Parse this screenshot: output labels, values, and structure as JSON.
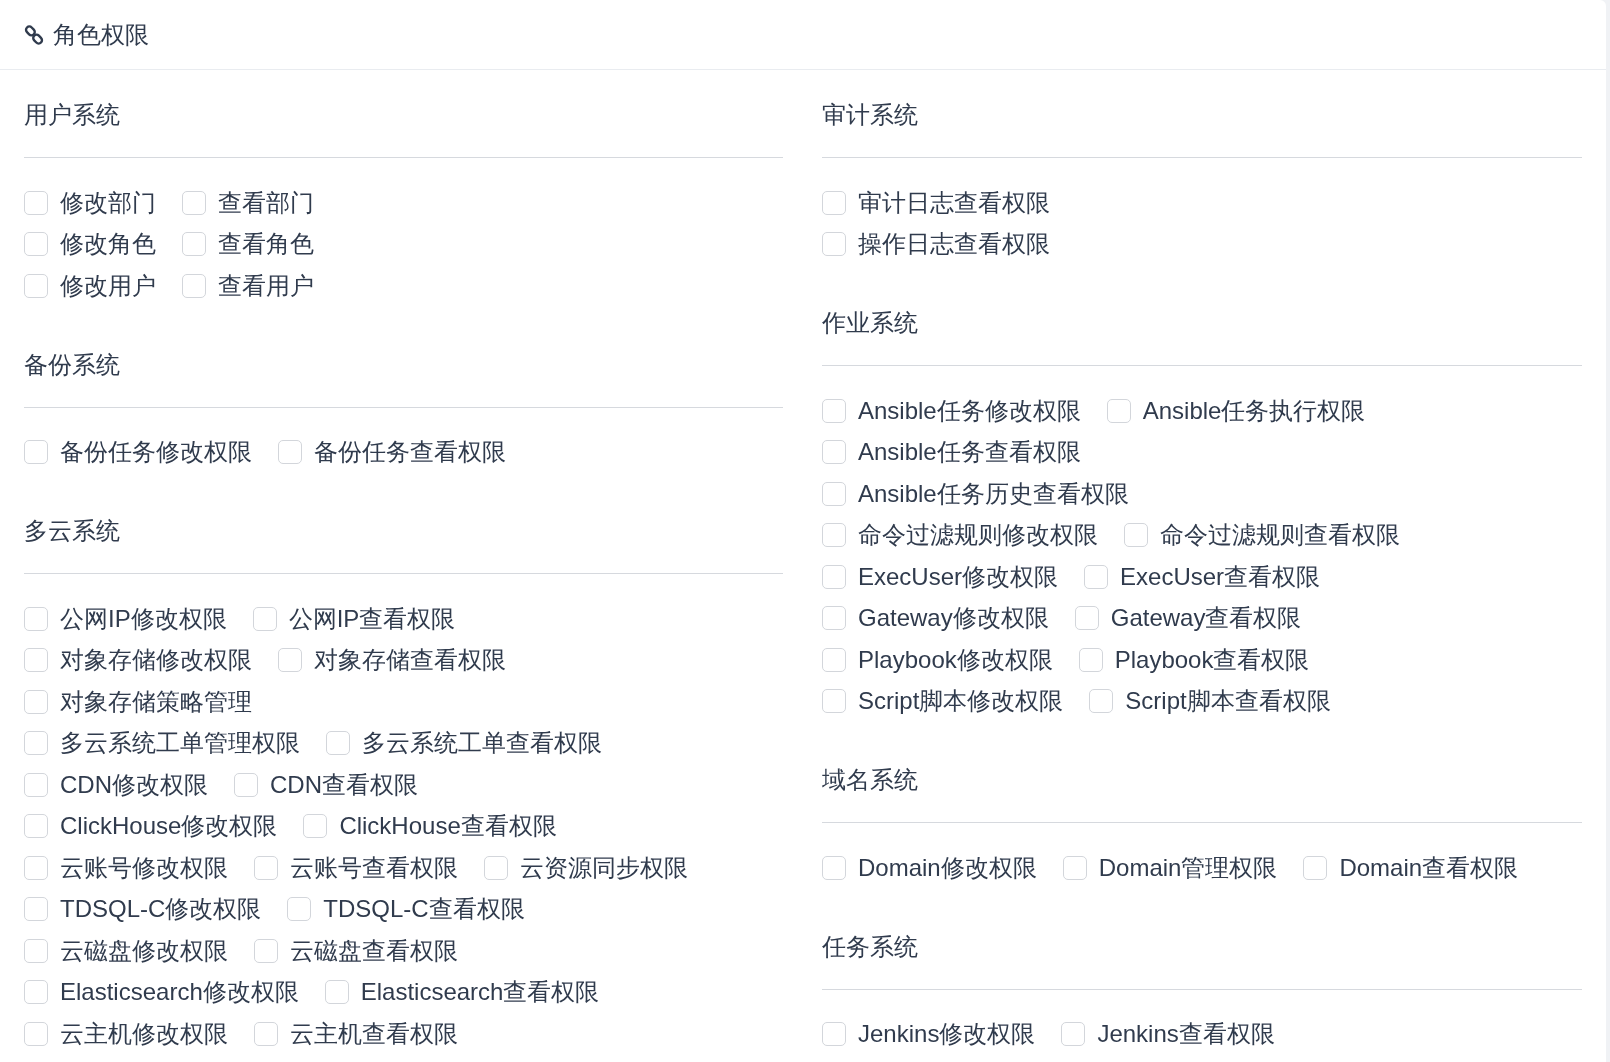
{
  "header": {
    "title": "角色权限"
  },
  "columns": [
    {
      "sections": [
        {
          "title": "用户系统",
          "rows": [
            {
              "options": [
                {
                  "label": "修改部门",
                  "checked": false
                },
                {
                  "label": "查看部门",
                  "checked": false
                }
              ]
            },
            {
              "options": [
                {
                  "label": "修改角色",
                  "checked": false
                },
                {
                  "label": "查看角色",
                  "checked": false
                }
              ]
            },
            {
              "options": [
                {
                  "label": "修改用户",
                  "checked": false
                },
                {
                  "label": "查看用户",
                  "checked": false
                }
              ]
            }
          ]
        },
        {
          "title": "备份系统",
          "rows": [
            {
              "options": [
                {
                  "label": "备份任务修改权限",
                  "checked": false
                },
                {
                  "label": "备份任务查看权限",
                  "checked": false
                }
              ]
            }
          ]
        },
        {
          "title": "多云系统",
          "rows": [
            {
              "options": [
                {
                  "label": "公网IP修改权限",
                  "checked": false
                },
                {
                  "label": "公网IP查看权限",
                  "checked": false
                }
              ]
            },
            {
              "options": [
                {
                  "label": "对象存储修改权限",
                  "checked": false
                },
                {
                  "label": "对象存储查看权限",
                  "checked": false
                }
              ]
            },
            {
              "options": [
                {
                  "label": "对象存储策略管理",
                  "checked": false
                }
              ]
            },
            {
              "options": [
                {
                  "label": "多云系统工单管理权限",
                  "checked": false
                },
                {
                  "label": "多云系统工单查看权限",
                  "checked": false
                }
              ]
            },
            {
              "options": [
                {
                  "label": "CDN修改权限",
                  "checked": false
                },
                {
                  "label": "CDN查看权限",
                  "checked": false
                }
              ]
            },
            {
              "options": [
                {
                  "label": "ClickHouse修改权限",
                  "checked": false
                },
                {
                  "label": "ClickHouse查看权限",
                  "checked": false
                }
              ]
            },
            {
              "options": [
                {
                  "label": "云账号修改权限",
                  "checked": false
                },
                {
                  "label": "云账号查看权限",
                  "checked": false
                },
                {
                  "label": "云资源同步权限",
                  "checked": false
                }
              ]
            },
            {
              "options": [
                {
                  "label": "TDSQL-C修改权限",
                  "checked": false
                },
                {
                  "label": "TDSQL-C查看权限",
                  "checked": false
                }
              ]
            },
            {
              "options": [
                {
                  "label": "云磁盘修改权限",
                  "checked": false
                },
                {
                  "label": "云磁盘查看权限",
                  "checked": false
                }
              ]
            },
            {
              "options": [
                {
                  "label": "Elasticsearch修改权限",
                  "checked": false
                },
                {
                  "label": "Elasticsearch查看权限",
                  "checked": false
                }
              ]
            },
            {
              "options": [
                {
                  "label": "云主机修改权限",
                  "checked": false
                },
                {
                  "label": "云主机查看权限",
                  "checked": false
                }
              ]
            }
          ]
        }
      ]
    },
    {
      "sections": [
        {
          "title": "审计系统",
          "rows": [
            {
              "options": [
                {
                  "label": "审计日志查看权限",
                  "checked": false
                }
              ]
            },
            {
              "options": [
                {
                  "label": "操作日志查看权限",
                  "checked": false
                }
              ]
            }
          ]
        },
        {
          "title": "作业系统",
          "rows": [
            {
              "options": [
                {
                  "label": "Ansible任务修改权限",
                  "checked": false
                },
                {
                  "label": "Ansible任务执行权限",
                  "checked": false
                }
              ]
            },
            {
              "options": [
                {
                  "label": "Ansible任务查看权限",
                  "checked": false
                }
              ]
            },
            {
              "options": [
                {
                  "label": "Ansible任务历史查看权限",
                  "checked": false
                }
              ]
            },
            {
              "options": [
                {
                  "label": "命令过滤规则修改权限",
                  "checked": false
                },
                {
                  "label": "命令过滤规则查看权限",
                  "checked": false
                }
              ]
            },
            {
              "options": [
                {
                  "label": "ExecUser修改权限",
                  "checked": false
                },
                {
                  "label": "ExecUser查看权限",
                  "checked": false
                }
              ]
            },
            {
              "options": [
                {
                  "label": "Gateway修改权限",
                  "checked": false
                },
                {
                  "label": "Gateway查看权限",
                  "checked": false
                }
              ]
            },
            {
              "options": [
                {
                  "label": "Playbook修改权限",
                  "checked": false
                },
                {
                  "label": "Playbook查看权限",
                  "checked": false
                }
              ]
            },
            {
              "options": [
                {
                  "label": "Script脚本修改权限",
                  "checked": false
                },
                {
                  "label": "Script脚本查看权限",
                  "checked": false
                }
              ]
            }
          ]
        },
        {
          "title": "域名系统",
          "rows": [
            {
              "options": [
                {
                  "label": "Domain修改权限",
                  "checked": false
                },
                {
                  "label": "Domain管理权限",
                  "checked": false
                },
                {
                  "label": "Domain查看权限",
                  "checked": false
                }
              ]
            }
          ]
        },
        {
          "title": "任务系统",
          "rows": [
            {
              "options": [
                {
                  "label": "Jenkins修改权限",
                  "checked": false
                },
                {
                  "label": "Jenkins查看权限",
                  "checked": false
                }
              ]
            }
          ]
        }
      ]
    }
  ]
}
